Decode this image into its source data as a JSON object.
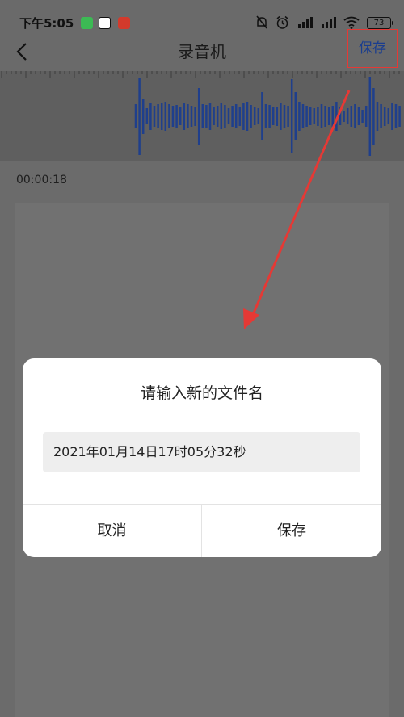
{
  "status_bar": {
    "time": "下午5:05",
    "battery": "73",
    "app_icons": [
      "shield-app-icon",
      "du-app-icon",
      "weibo-app-icon"
    ],
    "right_icons": [
      "mute-bell-icon",
      "alarm-icon",
      "hd-signal-icon",
      "hd-signal-icon",
      "wifi-icon"
    ]
  },
  "nav": {
    "back_icon": "chevron-left-icon",
    "title": "录音机",
    "save_label": "保存"
  },
  "recording": {
    "elapsed": "00:00:18"
  },
  "dialog": {
    "title": "请输入新的文件名",
    "filename_value": "2021年01月14日17时05分32秒",
    "cancel_label": "取消",
    "save_label": "保存"
  },
  "colors": {
    "accent_blue": "#1a3d8f",
    "waveform": "#1f3f8c",
    "annotation_red": "#e53935"
  }
}
